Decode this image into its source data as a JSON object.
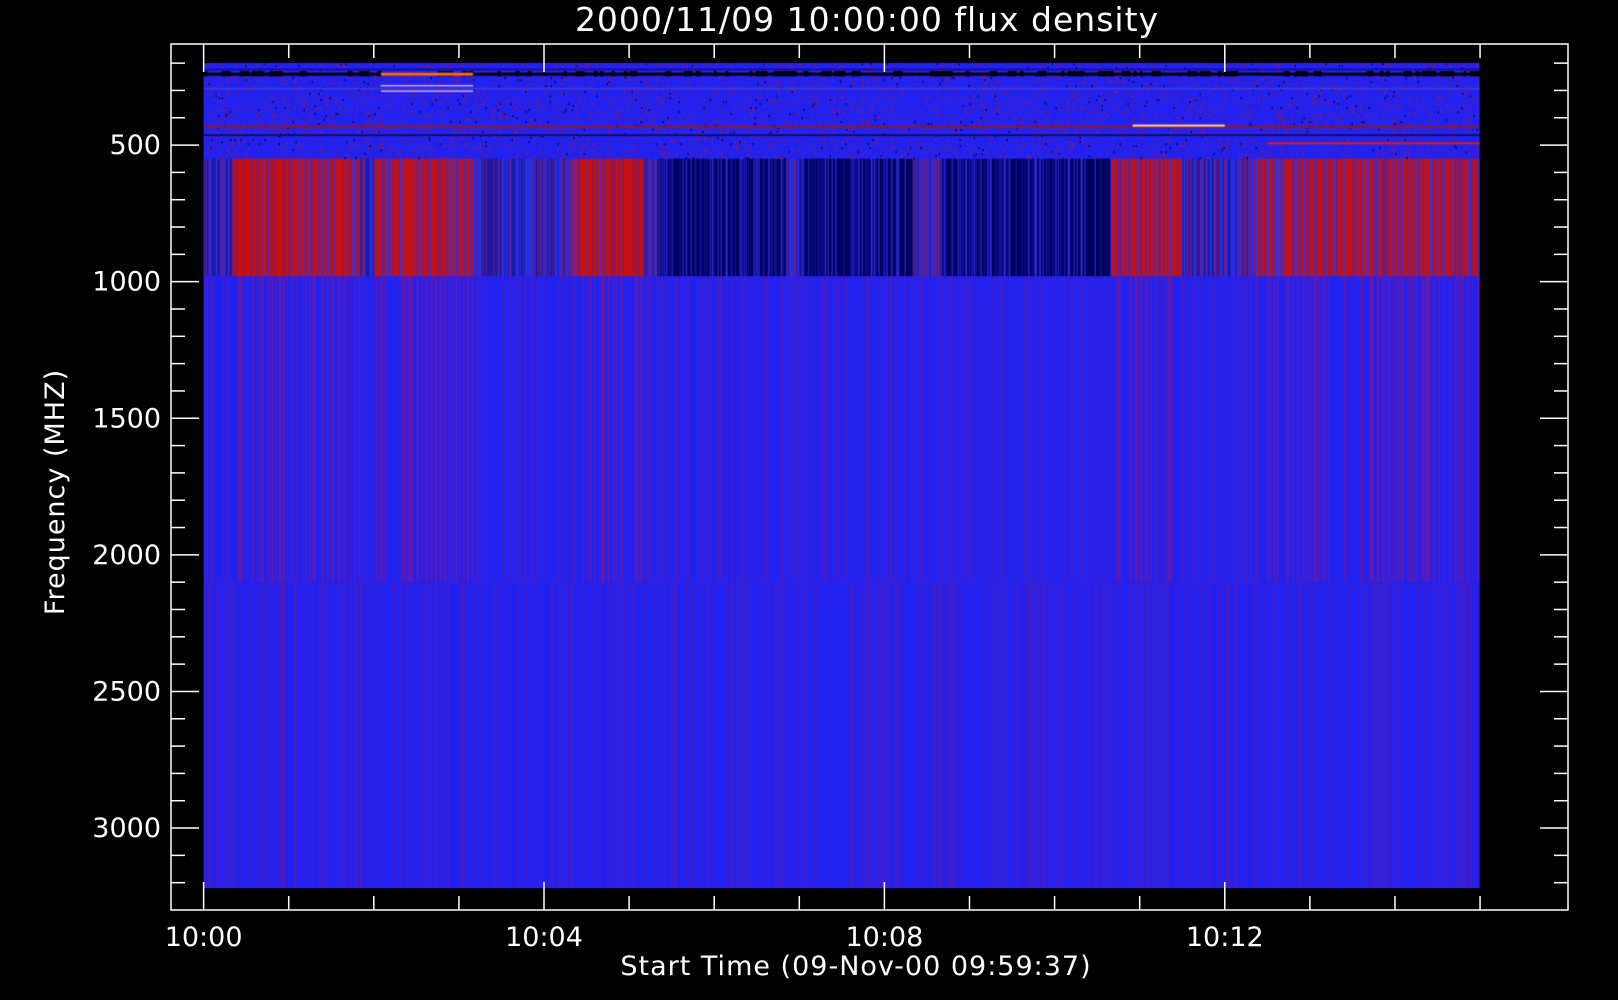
{
  "chart_data": {
    "type": "heatmap",
    "title": "2000/11/09 10:00:00 flux density",
    "xlabel": "Start Time (09-Nov-00 09:59:37)",
    "ylabel": "Frequency (MHZ)",
    "x_ticks": [
      "10:00",
      "10:04",
      "10:08",
      "10:12"
    ],
    "y_ticks": [
      500,
      1000,
      1500,
      2000,
      2500,
      3000
    ],
    "xlim": [
      "09:59:37",
      "10:16:02"
    ],
    "ylim": [
      3300,
      130
    ],
    "y_reversed": true,
    "data_extent": {
      "x_start": "10:00:00",
      "x_end": "10:15:00",
      "freq_min": 200,
      "freq_max": 3220
    },
    "bands": [
      {
        "freq_range": [
          200,
          550
        ],
        "description_color": "blue with red/orange/black horizontal streaks"
      },
      {
        "freq_range": [
          550,
          980
        ],
        "description_color": "dark blue / red alternating vertical stripes"
      },
      {
        "freq_range": [
          980,
          3220
        ],
        "description_color": "blue with faint red vertical stripes"
      }
    ],
    "red_episodes": [
      [
        "10:00:20",
        "10:01:50"
      ],
      [
        "10:02:00",
        "10:03:10"
      ],
      [
        "10:04:20",
        "10:05:10"
      ],
      [
        "10:10:40",
        "10:11:30"
      ],
      [
        "10:12:20",
        "10:15:00"
      ]
    ],
    "dark_episodes": [
      [
        "10:05:20",
        "10:06:50"
      ],
      [
        "10:07:00",
        "10:08:20"
      ],
      [
        "10:08:40",
        "10:10:40"
      ]
    ],
    "colors": {
      "background": "#000000",
      "axes": "#ffffff",
      "base_blue": "#2222f0",
      "red_high": "#c41010",
      "dark_low": "#000060",
      "streak_orange": "#ff6a1a"
    },
    "grid": false,
    "legend": "none"
  }
}
